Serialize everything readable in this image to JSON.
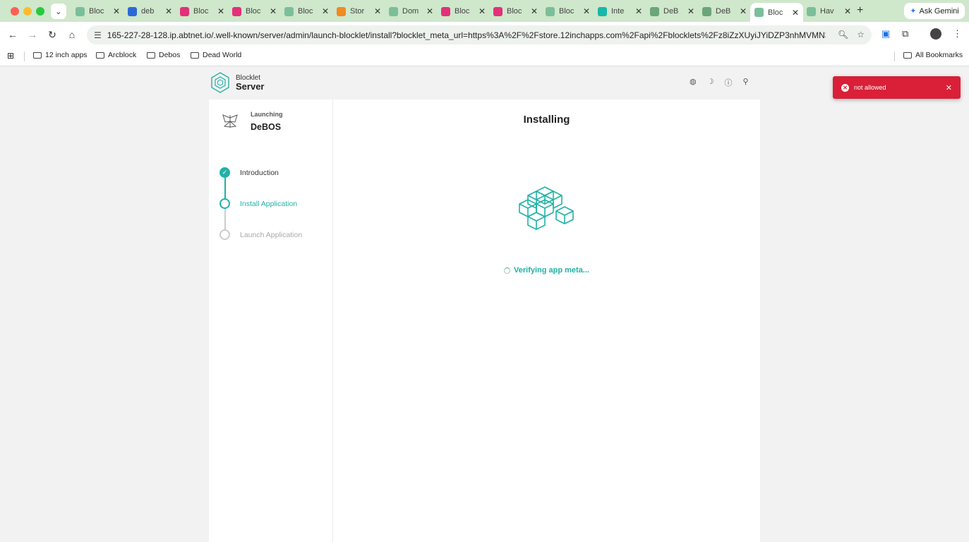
{
  "browser": {
    "tabs": [
      {
        "title": "Bloc",
        "color": "#7bbf9a"
      },
      {
        "title": "deb",
        "color": "#2b6ad6"
      },
      {
        "title": "Bloc",
        "color": "#e3307a"
      },
      {
        "title": "Bloc",
        "color": "#e3307a"
      },
      {
        "title": "Bloc",
        "color": "#7bbf9a"
      },
      {
        "title": "Stor",
        "color": "#f08a24"
      },
      {
        "title": "Dom",
        "color": "#7bbf9a"
      },
      {
        "title": "Bloc",
        "color": "#e3307a"
      },
      {
        "title": "Bloc",
        "color": "#e3307a"
      },
      {
        "title": "Bloc",
        "color": "#7bbf9a"
      },
      {
        "title": "Inte",
        "color": "#18b7a8"
      },
      {
        "title": "DeB",
        "color": "#6aa67a"
      },
      {
        "title": "DeB",
        "color": "#6aa67a"
      },
      {
        "title": "Bloc",
        "color": "#7bbf9a"
      },
      {
        "title": "Hav",
        "color": "#7bbf9a"
      }
    ],
    "active_tab_index": 13,
    "ask_gemini": "Ask Gemini",
    "url": "165-227-28-128.ip.abtnet.io/.well-known/server/admin/launch-blocklet/install?blocklet_meta_url=https%3A%2F%2Fstore.12inchapps.com%2Fapi%2Fblocklets%2Fz8iZzXUyiJYiDZP3nhMVMN3e...",
    "bookmarks": [
      "12 inch apps",
      "Arcblock",
      "Debos",
      "Dead World"
    ],
    "all_bookmarks": "All Bookmarks"
  },
  "header": {
    "logo_small": "Blocklet",
    "logo_big": "Server"
  },
  "sidebar": {
    "launching_label": "Launching",
    "app_name": "DeBOS",
    "steps": [
      {
        "label": "Introduction",
        "state": "done"
      },
      {
        "label": "Install Application",
        "state": "active"
      },
      {
        "label": "Launch Application",
        "state": "pending"
      }
    ]
  },
  "main": {
    "title": "Installing",
    "status": "Verifying app meta..."
  },
  "toast": {
    "message": "not allowed",
    "color": "#d92038"
  },
  "colors": {
    "accent": "#20b2a6"
  }
}
